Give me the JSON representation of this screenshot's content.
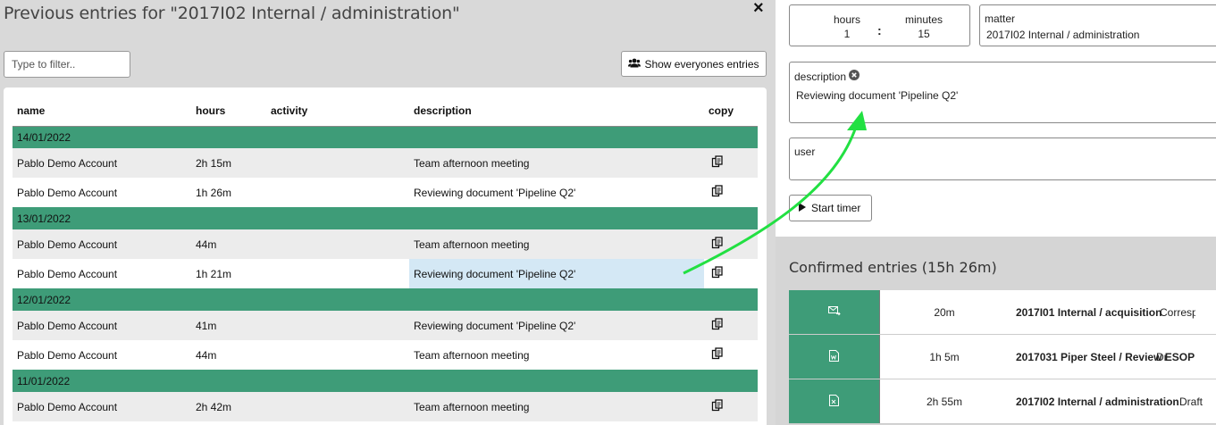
{
  "modal": {
    "title": "Previous entries for \"2017I02 Internal / administration\"",
    "close_glyph": "×",
    "filter_placeholder": "Type to filter..",
    "show_all_label": "Show everyones entries"
  },
  "table": {
    "columns": [
      "name",
      "hours",
      "activity",
      "description",
      "copy"
    ],
    "groups": [
      {
        "date": "14/01/2022",
        "rows": [
          {
            "name": "Pablo Demo Account",
            "hours": "2h 15m",
            "activity": "",
            "description": "Team afternoon meeting"
          },
          {
            "name": "Pablo Demo Account",
            "hours": "1h 26m",
            "activity": "",
            "description": "Reviewing document 'Pipeline Q2'"
          }
        ]
      },
      {
        "date": "13/01/2022",
        "rows": [
          {
            "name": "Pablo Demo Account",
            "hours": "44m",
            "activity": "",
            "description": "Team afternoon meeting"
          },
          {
            "name": "Pablo Demo Account",
            "hours": "1h 21m",
            "activity": "",
            "description": "Reviewing document 'Pipeline Q2'",
            "highlighted": true
          }
        ]
      },
      {
        "date": "12/01/2022",
        "rows": [
          {
            "name": "Pablo Demo Account",
            "hours": "41m",
            "activity": "",
            "description": "Reviewing document 'Pipeline Q2'"
          },
          {
            "name": "Pablo Demo Account",
            "hours": "44m",
            "activity": "",
            "description": "Team afternoon meeting"
          }
        ]
      },
      {
        "date": "11/01/2022",
        "rows": [
          {
            "name": "Pablo Demo Account",
            "hours": "2h 42m",
            "activity": "",
            "description": "Team afternoon meeting"
          }
        ]
      }
    ]
  },
  "form": {
    "hours_label": "hours",
    "hours_value": "1",
    "minutes_label": "minutes",
    "minutes_value": "15",
    "separator": ":",
    "matter_label": "matter",
    "matter_value": "2017I02 Internal / administration",
    "description_label": "description",
    "description_value": "Reviewing document 'Pipeline Q2'",
    "user_label": "user",
    "user_value": "",
    "start_timer_label": "Start timer"
  },
  "confirmed": {
    "title": "Confirmed entries (15h 26m)",
    "entries": [
      {
        "icon": "email-icon",
        "duration": "20m",
        "matter": "2017I01 Internal / acquisition",
        "desc": "Corresp"
      },
      {
        "icon": "word-doc-icon",
        "duration": "1h 5m",
        "matter": "2017031 Piper Steel / Review ESOP",
        "desc": "Dr"
      },
      {
        "icon": "excel-doc-icon",
        "duration": "2h 55m",
        "matter": "2017I02 Internal / administration",
        "desc": "Draft"
      }
    ]
  },
  "colors": {
    "accent_green": "#3e9c78",
    "highlight_blue": "#d4e8f5",
    "arrow_green": "#22e042"
  }
}
